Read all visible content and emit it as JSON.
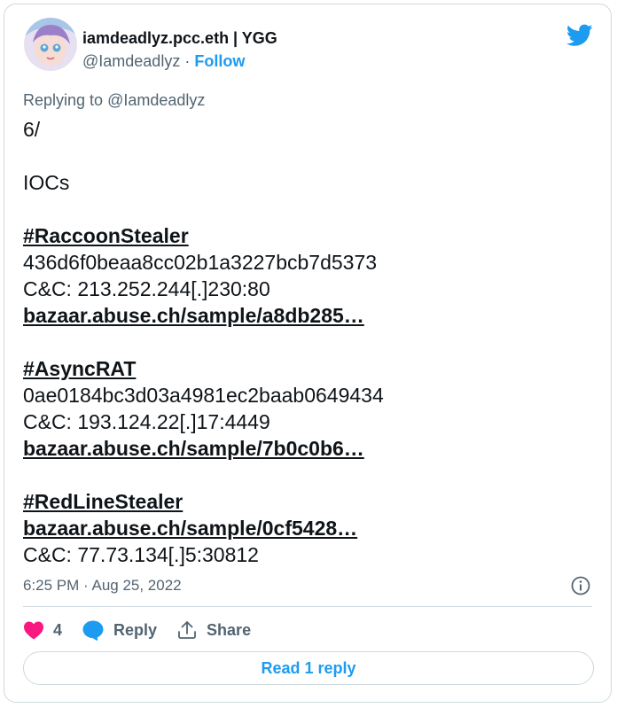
{
  "author": {
    "display_name": "iamdeadlyz.pcc.eth | YGG",
    "handle": "@Iamdeadlyz",
    "separator": "·",
    "follow_label": "Follow"
  },
  "replying": {
    "prefix": "Replying to",
    "mention": "@Iamdeadlyz"
  },
  "tweet": {
    "line1": "6/",
    "line2": "IOCs",
    "raccoon_tag": "#RaccoonStealer",
    "raccoon_hash": "436d6f0beaa8cc02b1a3227bcb7d5373",
    "raccoon_cc": "C&C: 213.252.244[.]230:80",
    "raccoon_link": "bazaar.abuse.ch/sample/a8db285…",
    "async_tag": "#AsyncRAT",
    "async_hash": "0ae0184bc3d03a4981ec2baab0649434",
    "async_cc": "C&C: 193.124.22[.]17:4449",
    "async_link": "bazaar.abuse.ch/sample/7b0c0b6…",
    "redline_tag": "#RedLineStealer",
    "redline_link": "bazaar.abuse.ch/sample/0cf5428…",
    "redline_cc": "C&C: 77.73.134[.]5:30812"
  },
  "timestamp": "6:25 PM · Aug 25, 2022",
  "actions": {
    "like_count": "4",
    "reply_label": "Reply",
    "share_label": "Share"
  },
  "read_replies_label": "Read 1 reply",
  "colors": {
    "accent": "#1d9bf0",
    "like": "#f91880",
    "text": "#0f1419",
    "muted": "#536471",
    "border": "#cfd9de"
  },
  "icons": {
    "brand": "twitter-bird-icon",
    "like": "heart-icon",
    "reply": "speech-bubble-icon",
    "share": "share-upload-icon",
    "info": "info-icon"
  }
}
